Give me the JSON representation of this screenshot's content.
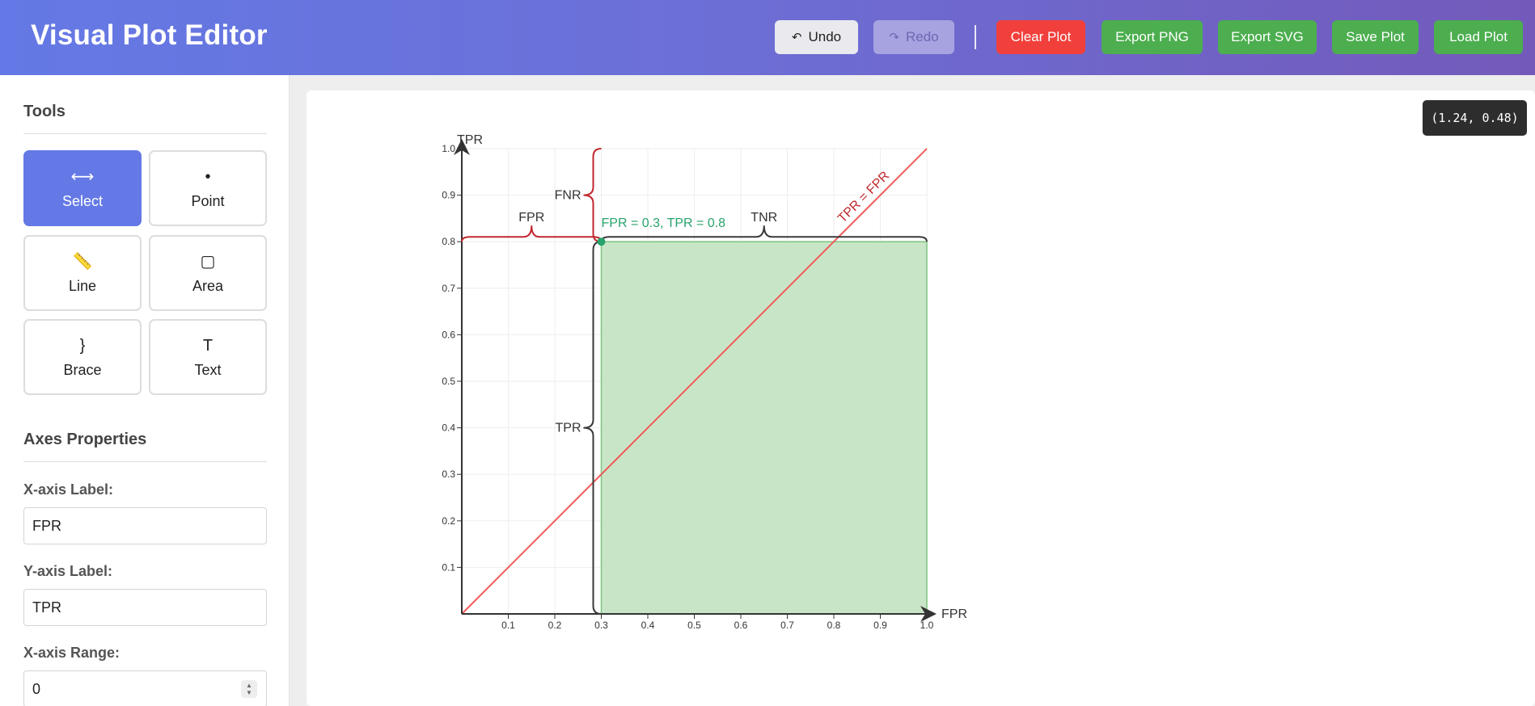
{
  "header": {
    "title": "Visual Plot Editor",
    "undo_label": "Undo",
    "redo_label": "Redo",
    "clear_label": "Clear Plot",
    "export_png_label": "Export PNG",
    "export_svg_label": "Export SVG",
    "save_label": "Save Plot",
    "load_label": "Load Plot",
    "undo_icon": "undo-icon",
    "redo_icon": "redo-icon"
  },
  "sidebar": {
    "tools_title": "Tools",
    "tools": [
      {
        "id": "select",
        "label": "Select",
        "glyph": "⟷",
        "icon": "arrows-horizontal-icon",
        "active": true
      },
      {
        "id": "point",
        "label": "Point",
        "glyph": "•",
        "icon": "dot-icon",
        "active": false
      },
      {
        "id": "line",
        "label": "Line",
        "glyph": "📏",
        "icon": "ruler-icon",
        "active": false
      },
      {
        "id": "area",
        "label": "Area",
        "glyph": "▢",
        "icon": "square-icon",
        "active": false
      },
      {
        "id": "brace",
        "label": "Brace",
        "glyph": "}",
        "icon": "brace-icon",
        "active": false
      },
      {
        "id": "text",
        "label": "Text",
        "glyph": "T",
        "icon": "text-icon",
        "active": false
      }
    ],
    "axes_title": "Axes Properties",
    "x_label_label": "X-axis Label:",
    "x_label_value": "FPR",
    "y_label_label": "Y-axis Label:",
    "y_label_value": "TPR",
    "x_range_label": "X-axis Range:",
    "x_range_min": "0"
  },
  "cursor_readout": "(1.24, 0.48)",
  "colors": {
    "accent": "#6479e5",
    "danger": "#f1403c",
    "success": "#4cae4f",
    "area_fill": "#c8e6c7",
    "area_stroke": "#7cc37f",
    "diagonal": "#f25a5a",
    "brace_red": "#c0282e",
    "brace_dark": "#3a3a3a",
    "point": "#27a36b"
  },
  "chart_data": {
    "type": "area",
    "xlabel": "FPR",
    "ylabel": "TPR",
    "xlim": [
      0,
      1
    ],
    "ylim": [
      0,
      1
    ],
    "x_ticks": [
      "0.1",
      "0.2",
      "0.3",
      "0.4",
      "0.5",
      "0.6",
      "0.7",
      "0.8",
      "0.9",
      "1.0"
    ],
    "y_ticks": [
      "0.1",
      "0.2",
      "0.3",
      "0.4",
      "0.5",
      "0.6",
      "0.7",
      "0.8",
      "0.9",
      "1.0"
    ],
    "x_tick_values": [
      0.1,
      0.2,
      0.3,
      0.4,
      0.5,
      0.6,
      0.7,
      0.8,
      0.9,
      1.0
    ],
    "y_tick_values": [
      0.1,
      0.2,
      0.3,
      0.4,
      0.5,
      0.6,
      0.7,
      0.8,
      0.9,
      1.0
    ],
    "grid": true,
    "area": {
      "x0": 0.3,
      "x1": 1.0,
      "y0": 0.0,
      "y1": 0.8
    },
    "diagonal": {
      "from": [
        0,
        0
      ],
      "to": [
        1,
        1
      ],
      "label": "TPR = FPR"
    },
    "point": {
      "x": 0.3,
      "y": 0.8,
      "label": "FPR = 0.3, TPR = 0.8"
    },
    "braces": [
      {
        "label": "FPR",
        "color": "red",
        "from": [
          0,
          0.8
        ],
        "to": [
          0.3,
          0.8
        ]
      },
      {
        "label": "FNR",
        "color": "red",
        "from": [
          0.3,
          0.8
        ],
        "to": [
          0.3,
          1.0
        ]
      },
      {
        "label": "TNR",
        "color": "dark",
        "from": [
          0.3,
          0.8
        ],
        "to": [
          1.0,
          0.8
        ]
      },
      {
        "label": "TPR",
        "color": "dark",
        "from": [
          0.3,
          0.0
        ],
        "to": [
          0.3,
          0.8
        ]
      }
    ]
  }
}
